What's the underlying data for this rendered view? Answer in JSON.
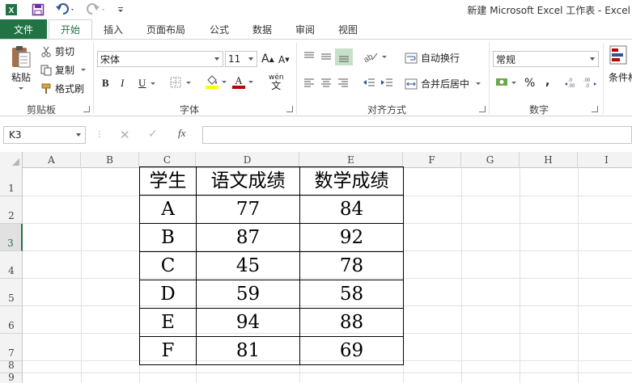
{
  "title_bar": {
    "title": "新建 Microsoft Excel 工作表 - Excel"
  },
  "tabs": {
    "file": "文件",
    "items": [
      "开始",
      "插入",
      "页面布局",
      "公式",
      "数据",
      "审阅",
      "视图"
    ],
    "active": "开始"
  },
  "ribbon": {
    "clipboard": {
      "paste": "粘贴",
      "cut": "剪切",
      "copy": "复制",
      "format_painter": "格式刷",
      "label": "剪贴板"
    },
    "font": {
      "font_name": "宋体",
      "font_size": "11",
      "grow": "A",
      "shrink": "A",
      "bold": "B",
      "italic": "I",
      "underline": "U",
      "phonetic": "wén",
      "label": "字体",
      "fill_color": "#ffff00",
      "font_color": "#c00000"
    },
    "alignment": {
      "wrap_text": "自动换行",
      "merge_center": "合并后居中",
      "label": "对齐方式"
    },
    "number": {
      "format": "常规",
      "percent": "%",
      "comma": ",",
      "label": "数字"
    },
    "styles": {
      "conditional_formatting": "条件格"
    }
  },
  "formula_bar": {
    "name_box": "K3",
    "fx": "fx",
    "formula": ""
  },
  "grid": {
    "columns": [
      "A",
      "B",
      "C",
      "D",
      "E",
      "F",
      "G",
      "H",
      "I"
    ],
    "rows": [
      "1",
      "2",
      "3",
      "4",
      "5",
      "6",
      "7",
      "8",
      "9"
    ],
    "active_row": "3",
    "table": {
      "headers": [
        "学生",
        "语文成绩",
        "数学成绩"
      ],
      "rows": [
        [
          "A",
          "77",
          "84"
        ],
        [
          "B",
          "87",
          "92"
        ],
        [
          "C",
          "45",
          "78"
        ],
        [
          "D",
          "59",
          "58"
        ],
        [
          "E",
          "94",
          "88"
        ],
        [
          "F",
          "81",
          "69"
        ]
      ]
    }
  },
  "colors": {
    "accent": "#217346"
  }
}
